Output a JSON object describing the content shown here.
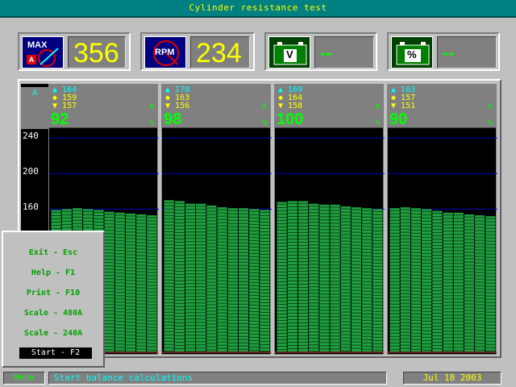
{
  "title": "Cylinder resistance test",
  "gauges": [
    {
      "icon_text": "MAX",
      "icon_sub": "A",
      "value": "356",
      "icon": "max-amps-icon"
    },
    {
      "icon_text": "RPM",
      "value": "234",
      "icon": "rpm-icon"
    },
    {
      "icon_text": "V",
      "value": "--",
      "icon": "battery-voltage-icon"
    },
    {
      "icon_text": "%",
      "value": "--",
      "icon": "battery-percent-icon"
    }
  ],
  "scale": {
    "unit": "A",
    "ticks": [
      "240",
      "200",
      "160"
    ]
  },
  "cylinders": [
    {
      "max": "164",
      "avg": "159",
      "min": "157",
      "amp_unit": "A",
      "percent": "92",
      "pct_unit": "%"
    },
    {
      "max": "170",
      "avg": "163",
      "min": "156",
      "amp_unit": "A",
      "percent": "98",
      "pct_unit": "%"
    },
    {
      "max": "169",
      "avg": "164",
      "min": "158",
      "amp_unit": "A",
      "percent": "100",
      "pct_unit": "%"
    },
    {
      "max": "163",
      "avg": "157",
      "min": "151",
      "amp_unit": "A",
      "percent": "90",
      "pct_unit": "%"
    }
  ],
  "chart_data": {
    "type": "bar",
    "ylim": [
      0,
      250
    ],
    "ylabel": "A",
    "series": [
      {
        "values": [
          159,
          160,
          161,
          160,
          159,
          157,
          156,
          155,
          154,
          153
        ]
      },
      {
        "values": [
          170,
          169,
          166,
          166,
          164,
          162,
          161,
          161,
          160,
          159
        ]
      },
      {
        "values": [
          168,
          169,
          169,
          166,
          165,
          165,
          163,
          162,
          161,
          160
        ]
      },
      {
        "values": [
          161,
          162,
          161,
          160,
          158,
          156,
          156,
          154,
          153,
          152
        ]
      }
    ]
  },
  "menu": {
    "items": [
      "Exit - Esc",
      "Help - F1",
      "Print - F10",
      "Scale - 480A",
      "Scale - 240A"
    ],
    "start": "Start - F2"
  },
  "status": {
    "menu_label": "Menu",
    "message": "Start balance calculations",
    "date": "Jul 18 2003"
  },
  "colors": {
    "bar": "#20a040",
    "bar_edge": "#40ff60",
    "grid": "#0000c0"
  }
}
